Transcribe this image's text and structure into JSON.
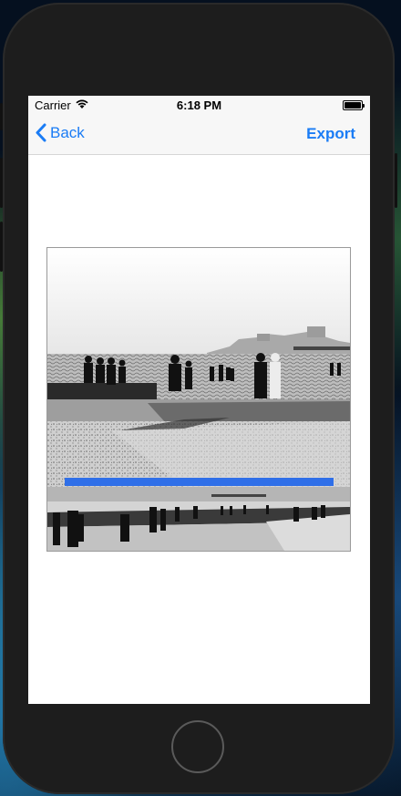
{
  "status_bar": {
    "carrier": "Carrier",
    "time": "6:18 PM",
    "wifi_icon": "wifi-icon",
    "battery_icon": "battery-icon"
  },
  "nav": {
    "back_label": "Back",
    "back_icon": "chevron-left-icon",
    "export_label": "Export"
  },
  "media": {
    "photo": "black-and-white beach photo with people on promenade",
    "progress_fraction": 1.0
  },
  "colors": {
    "accent": "#1a7cf5",
    "progress": "#2f6fe8"
  }
}
